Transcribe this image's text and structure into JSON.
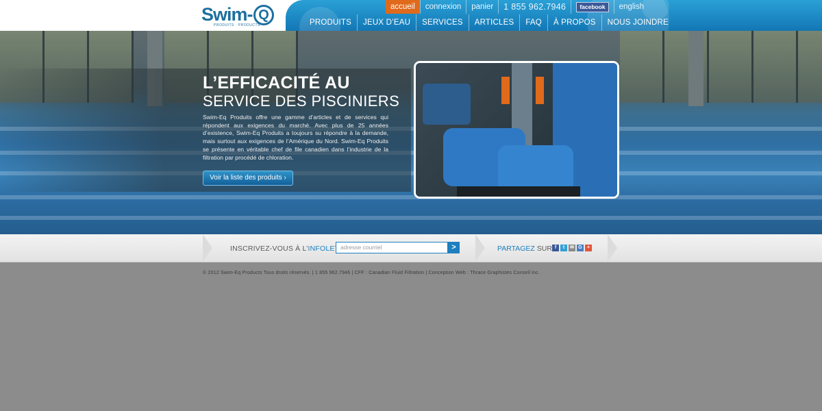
{
  "brand": {
    "name": "Swim-EQ",
    "subtitle": "PRODUITS · PRODUCTS",
    "accent": "#1d7fbf",
    "orange": "#e06a1c"
  },
  "topbar": {
    "items": [
      {
        "label": "accueil",
        "active": true
      },
      {
        "label": "connexion"
      },
      {
        "label": "panier"
      },
      {
        "label": "1 855 962.7946"
      },
      {
        "label": "facebook"
      },
      {
        "label": "english"
      }
    ]
  },
  "mainnav": {
    "items": [
      "PRODUITS",
      "JEUX D’EAU",
      "SERVICES",
      "ARTICLES",
      "FAQ",
      "À PROPOS",
      "NOUS JOINDRE"
    ]
  },
  "hero": {
    "title_line1": "L’EFFICACITÉ AU",
    "title_line2": "SERVICE DES PISCINIERS",
    "body": "Swim-Eq Produits offre une gamme d’articles et de services qui répondent aux exigences du marché. Avec plus de 25 années d’existence, Swim-Eq Produits a toujours su répondre à la demande, mais surtout aux exigences de l’Amérique du Nord. Swim-Eq Produits se présente en véritable chef de file canadien dans l’industrie de la filtration par procédé de chloration.",
    "cta": "Voir la liste des produits ›"
  },
  "newsletter": {
    "label_prefix": "INSCRIVEZ-VOUS À L’",
    "label_highlight": "INFOLETTRE",
    "label_suffix": " :",
    "placeholder": "adresse courriel",
    "submit": ">"
  },
  "share": {
    "label_highlight": "PARTAGEZ",
    "label_suffix": " SUR :",
    "icons": [
      {
        "name": "facebook-icon",
        "glyph": "f",
        "color": "#3b5998"
      },
      {
        "name": "twitter-icon",
        "glyph": "t",
        "color": "#33a0d6"
      },
      {
        "name": "email-icon",
        "glyph": "✉",
        "color": "#8a8a8a"
      },
      {
        "name": "google-icon",
        "glyph": "G",
        "color": "#4a7cc4"
      },
      {
        "name": "plus-icon",
        "glyph": "+",
        "color": "#e0563a"
      }
    ]
  },
  "footer": {
    "text": "© 2012 Swim-Eq Products Tous droits réservés. | 1 855 962.7946 | CFF : Canadian Fluid Filtration | Conception Web : Thrace Graphistes Conseil inc."
  }
}
